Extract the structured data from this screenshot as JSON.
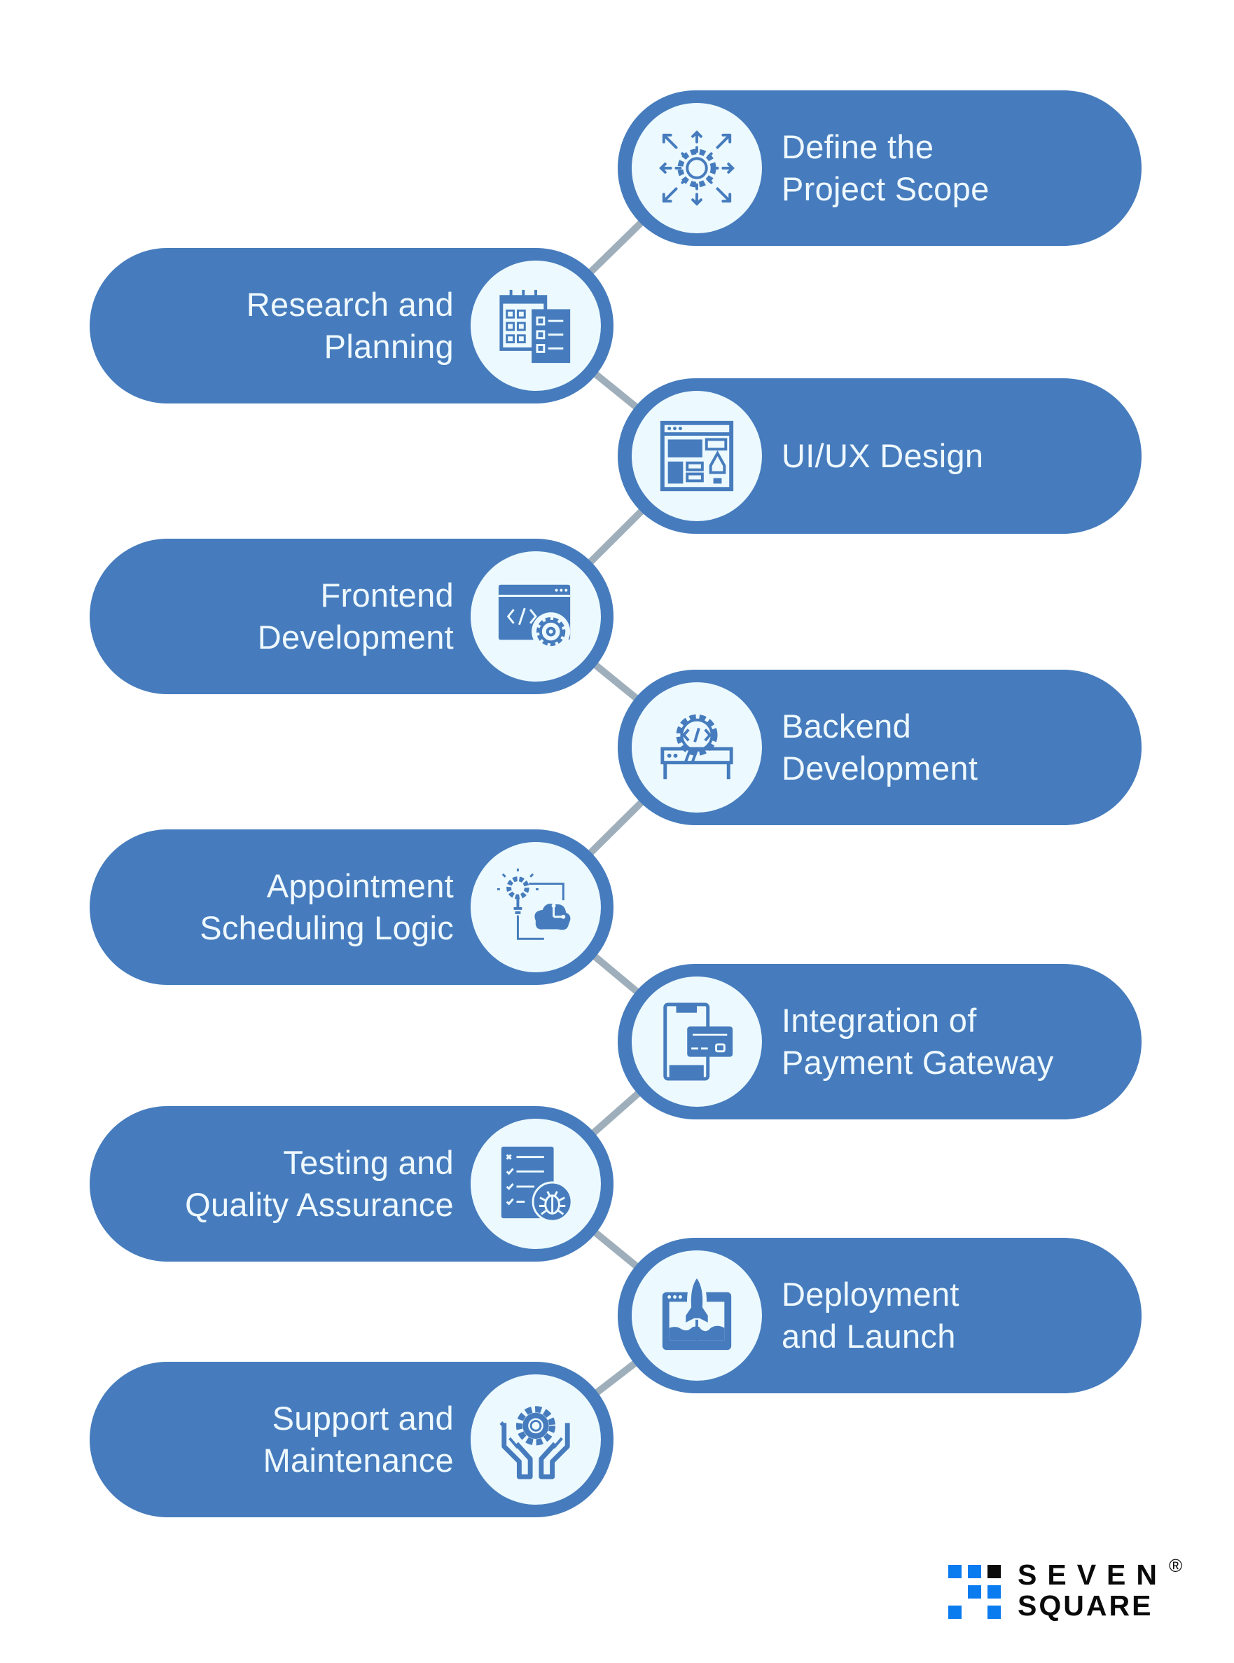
{
  "title": "App development process steps",
  "colors": {
    "pill": "#467cbd",
    "icon_bg": "#ecf9fe",
    "connector": "#9eafbb",
    "text": "#eef8fd",
    "logo_blue": "#0a7cf0",
    "logo_black": "#0a0a0a"
  },
  "steps": [
    {
      "side": "right",
      "lines": [
        "Define the",
        "Project Scope"
      ],
      "icon": "gear-arrows-icon"
    },
    {
      "side": "left",
      "lines": [
        "Research and",
        "Planning"
      ],
      "icon": "calendar-checklist-icon"
    },
    {
      "side": "right",
      "lines": [
        "UI/UX Design"
      ],
      "icon": "wireframe-pen-icon"
    },
    {
      "side": "left",
      "lines": [
        "Frontend",
        "Development"
      ],
      "icon": "code-window-gear-icon"
    },
    {
      "side": "right",
      "lines": [
        "Backend",
        "Development"
      ],
      "icon": "server-code-gear-icon"
    },
    {
      "side": "left",
      "lines": [
        "Appointment",
        "Scheduling Logic"
      ],
      "icon": "lightbulb-cloud-icon"
    },
    {
      "side": "right",
      "lines": [
        "Integration of",
        "Payment Gateway"
      ],
      "icon": "phone-card-icon"
    },
    {
      "side": "left",
      "lines": [
        "Testing and",
        "Quality Assurance"
      ],
      "icon": "checklist-bug-icon"
    },
    {
      "side": "right",
      "lines": [
        "Deployment",
        "and Launch"
      ],
      "icon": "rocket-window-icon"
    },
    {
      "side": "left",
      "lines": [
        "Support and",
        "Maintenance"
      ],
      "icon": "hands-gear-icon"
    }
  ],
  "logo": {
    "line1": "SEVEN",
    "line2": "SQUARE",
    "registered": "®",
    "grid": [
      [
        "blue",
        "blue",
        "black"
      ],
      [
        "none",
        "blue",
        "blue"
      ],
      [
        "blue",
        "none",
        "blue"
      ]
    ]
  }
}
